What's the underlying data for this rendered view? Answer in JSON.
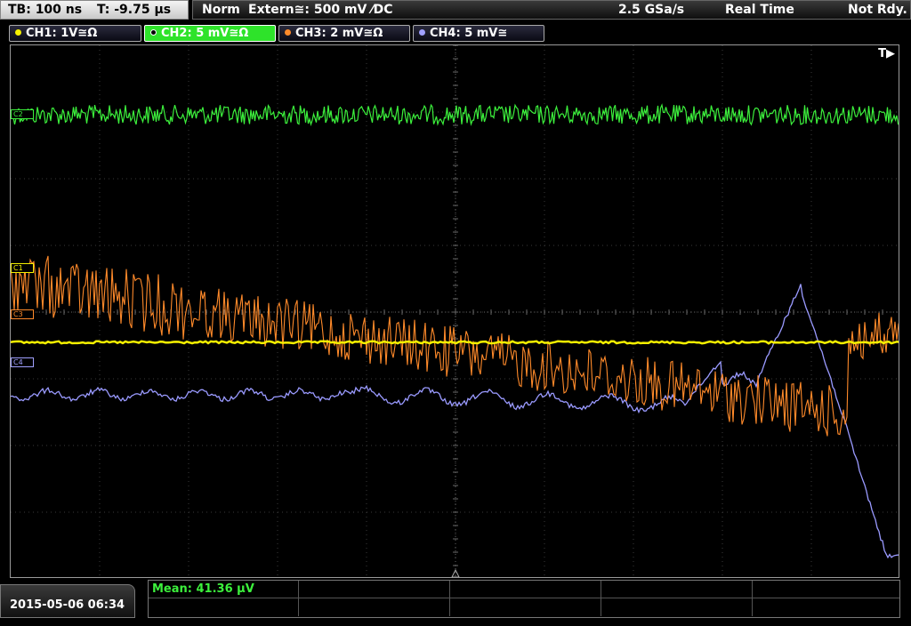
{
  "timebase": {
    "tb": "TB: 100 ns",
    "t": "T: -9.75 µs"
  },
  "status": {
    "mode": "Norm",
    "trigger": "Extern≅: 500 mV ⁄DC",
    "sample_rate": "2.5 GSa/s",
    "acq": "Real Time",
    "state": "Not Rdy."
  },
  "channels": [
    {
      "label": "CH1: 1V≅Ω",
      "color": "#f5f000"
    },
    {
      "label": "CH2: 5 mV≅Ω",
      "color": "#3cf03c"
    },
    {
      "label": "CH3: 2 mV≅Ω",
      "color": "#ff8a2a"
    },
    {
      "label": "CH4: 5 mV≅",
      "color": "#a0a0ff"
    }
  ],
  "markers": {
    "c1": "C1",
    "c2": "C2",
    "c3": "C3",
    "c4": "C4"
  },
  "trigger_marker": "T▶",
  "date": "2015-05-06 06:34",
  "measurement": "Mean: 41.36 µV"
}
